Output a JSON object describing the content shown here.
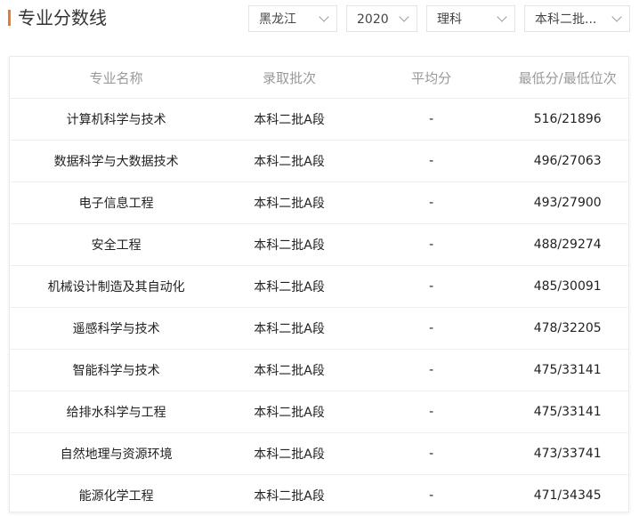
{
  "header": {
    "title": "专业分数线"
  },
  "filters": {
    "province": "黑龙江",
    "year": "2020",
    "subject": "理科",
    "batch": "本科二批..."
  },
  "table": {
    "columns": [
      "专业名称",
      "录取批次",
      "平均分",
      "最低分/最低位次"
    ],
    "rows": [
      [
        "计算机科学与技术",
        "本科二批A段",
        "-",
        "516/21896"
      ],
      [
        "数据科学与大数据技术",
        "本科二批A段",
        "-",
        "496/27063"
      ],
      [
        "电子信息工程",
        "本科二批A段",
        "-",
        "493/27900"
      ],
      [
        "安全工程",
        "本科二批A段",
        "-",
        "488/29274"
      ],
      [
        "机械设计制造及其自动化",
        "本科二批A段",
        "-",
        "485/30091"
      ],
      [
        "遥感科学与技术",
        "本科二批A段",
        "-",
        "478/32205"
      ],
      [
        "智能科学与技术",
        "本科二批A段",
        "-",
        "475/33141"
      ],
      [
        "给排水科学与工程",
        "本科二批A段",
        "-",
        "475/33141"
      ],
      [
        "自然地理与资源环境",
        "本科二批A段",
        "-",
        "473/33741"
      ],
      [
        "能源化学工程",
        "本科二批A段",
        "-",
        "471/34345"
      ]
    ]
  },
  "colors": {
    "accent": "#f0782a"
  }
}
